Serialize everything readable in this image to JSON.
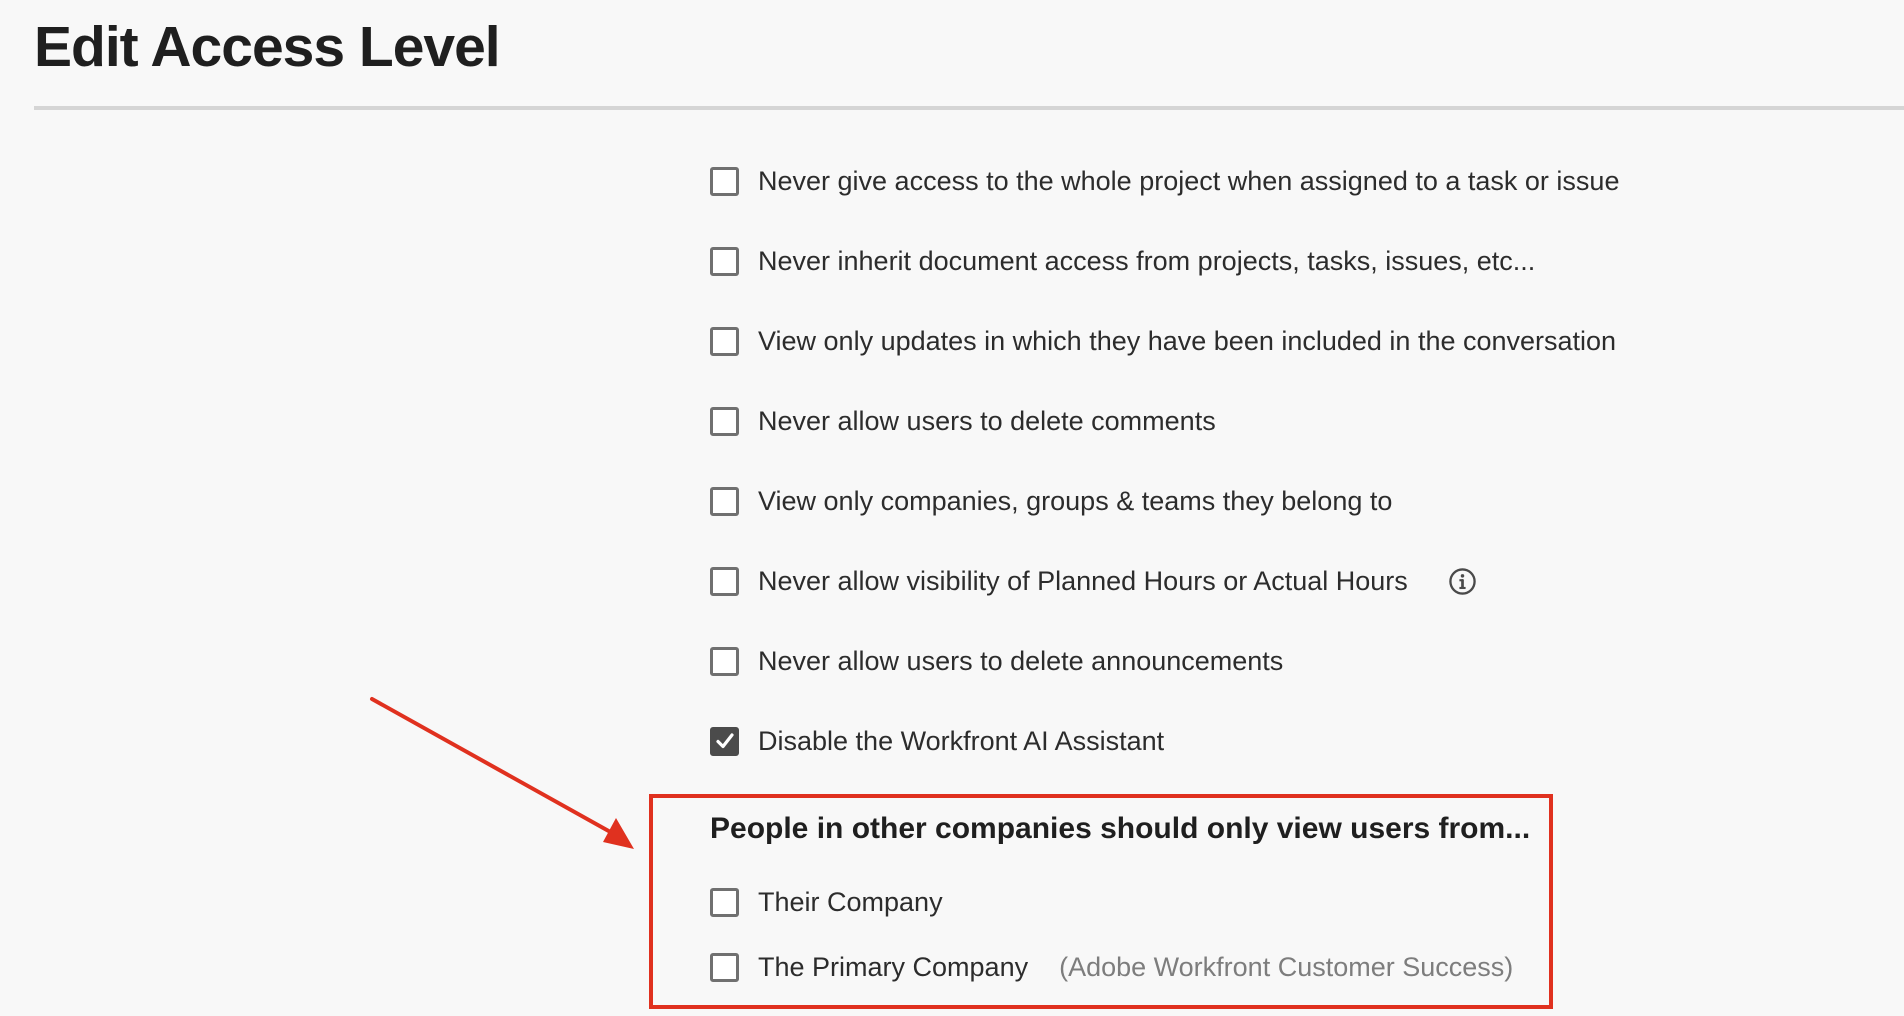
{
  "page": {
    "title": "Edit Access Level"
  },
  "options": [
    {
      "label": "Never give access to the whole project when assigned to a task or issue",
      "checked": false
    },
    {
      "label": "Never inherit document access from projects, tasks, issues, etc...",
      "checked": false
    },
    {
      "label": "View only updates in which they have been included in the conversation",
      "checked": false
    },
    {
      "label": "Never allow users to delete comments",
      "checked": false
    },
    {
      "label": "View only companies, groups & teams they belong to",
      "checked": false
    },
    {
      "label": "Never allow visibility of Planned Hours or Actual Hours",
      "checked": false,
      "icon": "info-icon"
    },
    {
      "label": "Never allow users to delete announcements",
      "checked": false
    },
    {
      "label": "Disable the Workfront AI Assistant",
      "checked": true
    }
  ],
  "company_visibility": {
    "heading": "People in other companies should only view users from...",
    "options": [
      {
        "label": "Their Company",
        "checked": false
      },
      {
        "label": "The Primary Company",
        "checked": false,
        "note": "(Adobe Workfront Customer Success)"
      }
    ]
  },
  "colors": {
    "annotation": "#e0311f",
    "checkbox_checked": "#4b4b4b",
    "checkbox_border": "#707070"
  }
}
